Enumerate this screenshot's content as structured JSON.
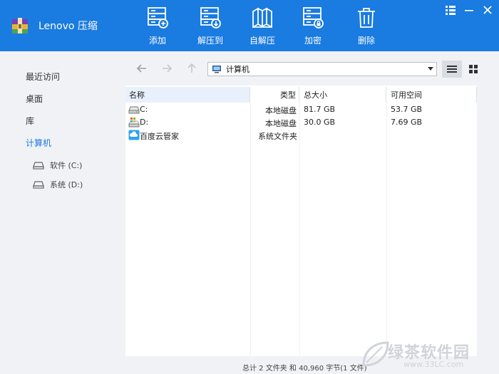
{
  "app": {
    "title": "Lenovo 压缩",
    "accent": "#1a7be0"
  },
  "toolbar": {
    "add_label": "添加",
    "extract_to_label": "解压到",
    "self_extract_label": "自解压",
    "encrypt_label": "加密",
    "delete_label": "删除"
  },
  "sidebar": {
    "recent": "最近访问",
    "desktop": "桌面",
    "library": "库",
    "computer": "计算机",
    "drive_c": "软件 (C:)",
    "drive_d": "系统 (D:)"
  },
  "address": {
    "path": "计算机"
  },
  "columns": {
    "name": "名称",
    "type": "类型",
    "total": "总大小",
    "free": "可用空间"
  },
  "rows": [
    {
      "name": "C:",
      "type": "本地磁盘",
      "total": "81.7 GB",
      "free": "53.7 GB",
      "icon": "hard-drive-icon"
    },
    {
      "name": "D:",
      "type": "本地磁盘",
      "total": "30.0 GB",
      "free": "7.69 GB",
      "icon": "system-drive-icon"
    },
    {
      "name": "百度云管家",
      "type": "系统文件夹",
      "total": "",
      "free": "",
      "icon": "baidu-cloud-icon"
    }
  ],
  "status": {
    "summary": "总计 2 文件夹 和 40,960 字节(1 文件)"
  },
  "watermark": {
    "text": "绿茶软件园",
    "url": "www.33LC.com"
  }
}
